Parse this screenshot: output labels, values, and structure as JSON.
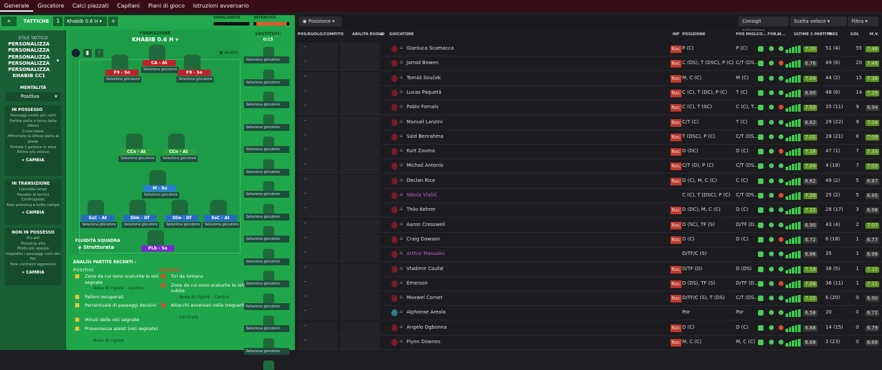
{
  "topnav": [
    "Generale",
    "Giocatore",
    "Calci piazzati",
    "Capitani",
    "Piani di gioco",
    "Istruzioni avversario"
  ],
  "tactics": {
    "label": "TATTICHE",
    "number": "1",
    "selected": "Khabib 0.6 H",
    "familiarity": "FAMILIARITÀ",
    "intensity": "INTENSITÀ"
  },
  "sidebar": {
    "style_title": "STILE TATTICO",
    "names": [
      "PERSONALIZZA",
      "PERSONALIZZA",
      "PERSONALIZZA",
      "PERSONALIZZA",
      "PERSONALIZZA",
      "KHABIB CC1"
    ],
    "mentality_title": "MENTALITÀ",
    "mentality": "Positiva",
    "in_possession": {
      "title": "IN POSSESSO",
      "lines": [
        "Passaggi molto più corti",
        "Partite palla a terra dalla difesa",
        "Cross bassi",
        "Affrontate la difesa palla al piede",
        "Portate il pallone in area",
        "Ritmo più veloce"
      ],
      "button": "CAMBIA"
    },
    "transition": {
      "title": "IN TRANSIZIONE",
      "lines": [
        "Lanciate lungo",
        "Passate ai terzini",
        "Contropiede",
        "Fate pressing a tutto campo"
      ],
      "button": "CAMBIA"
    },
    "out_possession": {
      "title": "NON IN POSSESSO",
      "lines": [
        "Più alti",
        "Pressing alto",
        "Molto più spesso",
        "Impedite i passaggi corti del Por",
        "Fate contrasti aggressivi"
      ],
      "button": "CAMBIA"
    }
  },
  "formation": {
    "title": "FORMAZIONE",
    "name": "KHABIB 0.6 H",
    "analysis": "Analisi",
    "fluidity_title": "FLUIDITÀ SQUADRA",
    "fluidity": "Strutturata"
  },
  "select_player": "Seleziona giocatore",
  "positions": [
    {
      "role": "F9 - So",
      "color": "#b8252c"
    },
    {
      "role": "CA - At",
      "color": "#b8252c"
    },
    {
      "role": "F9 - So",
      "color": "#b8252c"
    },
    {
      "role": "CCn - At",
      "color": "#2e9f3a"
    },
    {
      "role": "CCn - At",
      "color": "#2e9f3a"
    },
    {
      "role": "M - So",
      "color": "#2a7fd4"
    },
    {
      "role": "EsC - At",
      "color": "#2a68c8"
    },
    {
      "role": "Dlm - Df",
      "color": "#2a68c8"
    },
    {
      "role": "Dlm - Df",
      "color": "#2a68c8"
    },
    {
      "role": "EsC - At",
      "color": "#2a68c8"
    },
    {
      "role": "PLb - So",
      "color": "#7a2ad0"
    }
  ],
  "subs": {
    "title": "SOSTITUTI:",
    "count": "0/15"
  },
  "analysis": {
    "title": "ANALISI PARTITE RECENTI",
    "positive_title": "POSITIVI",
    "negative_title": "NEGATIVI",
    "positives": [
      {
        "text": "Zone da cui sono scaturite le reti segnate",
        "sub": "- Area di rigore - Centro"
      },
      {
        "text": "Palloni recuperati"
      },
      {
        "text": "Percentuale di passaggi decisivi"
      },
      {
        "text": "Minuti delle reti segnate"
      },
      {
        "text": "Provenienza assist (reti segnate)",
        "sub": "- Area di rigore"
      }
    ],
    "negatives": [
      {
        "text": "Tiri da lontano"
      },
      {
        "text": "Zone da cui sono scaturite le reti subite",
        "sub": "- Area di rigore - Centro"
      },
      {
        "text": "Attacchi avversari nella trequarti",
        "sub": "- Centrale"
      }
    ]
  },
  "right": {
    "position_btn": "Posizione",
    "consigli": "Consigli selezione",
    "scelta": "Scelta veloce",
    "filtra": "Filtra",
    "headers": [
      "POS/RUOLO/COMPITO",
      "ABILITÀ RUOLO",
      "IG",
      "GIOCATORE",
      "INF",
      "POSIZIONE",
      "POS MIGL",
      "CO...",
      "FOR...",
      "M...",
      "ULTIME 5 PARTITE",
      "PRES",
      "GOL",
      "M.V."
    ]
  },
  "players": [
    {
      "name": "Gianluca Scamacca",
      "inf": "Nac",
      "pos": "P (C)",
      "best": "P (C)",
      "last": "7.20",
      "pres": "51 (4)",
      "gol": "55",
      "mv": "7.46",
      "col": "#3ccb4a",
      "lc": "#5a8f1c"
    },
    {
      "name": "Jarrod Bowen",
      "inf": "Nac",
      "pos": "C (DS), T (DSC), P (C)",
      "best": "C/T (DS...",
      "last": "6.76",
      "pres": "49 (6)",
      "gol": "20",
      "mv": "7.48",
      "col": "#3ccb4a",
      "lc": "#3a3a3a"
    },
    {
      "name": "Tomáš Souček",
      "inf": "Nac",
      "pos": "M, C (C)",
      "best": "M (C)",
      "last": "7.04",
      "pres": "44 (2)",
      "gol": "15",
      "mv": "7.38",
      "col": "#3ccb4a",
      "lc": "#5a8f1c"
    },
    {
      "name": "Lucas Paquetá",
      "inf": "Nac",
      "pos": "C (C), T (DC), P (C)",
      "best": "T (C)",
      "last": "6.80",
      "pres": "48 (6)",
      "gol": "14",
      "mv": "7.29",
      "col": "#3ccb4a",
      "lc": "#3a3a3a"
    },
    {
      "name": "Pablo Fornals",
      "inf": "Nac",
      "pos": "C (C), T (SC)",
      "best": "C (C), T...",
      "last": "7.03",
      "pres": "35 (11)",
      "gol": "9",
      "mv": "6.94",
      "col": "#3ccb4a",
      "lc": "#5a8f1c"
    },
    {
      "name": "Manuel Lanzini",
      "inf": "Nac",
      "pos": "C/T (C)",
      "best": "T (C)",
      "last": "6.82",
      "pres": "29 (22)",
      "gol": "9",
      "mv": "7.04",
      "col": "#3ccb4a",
      "lc": "#3a3a3a"
    },
    {
      "name": "Said Benrahma",
      "inf": "Nac",
      "pos": "T (DSC), P (C)",
      "best": "C/T (DS...",
      "last": "7.02",
      "pres": "28 (21)",
      "gol": "8",
      "mv": "7.09",
      "col": "#3ccb4a",
      "lc": "#5a8f1c"
    },
    {
      "name": "Kurt Zouma",
      "inf": "Nac",
      "pos": "D (DC)",
      "best": "D (C)",
      "last": "7.16",
      "pres": "47 (1)",
      "gol": "7",
      "mv": "7.33",
      "col": "#3ccb4a",
      "lc": "#5a8f1c"
    },
    {
      "name": "Michail Antonio",
      "inf": "Nac",
      "pos": "C/T (D), P (C)",
      "best": "C/T (DS...",
      "last": "7.04",
      "pres": "4 (18)",
      "gol": "7",
      "mv": "7.02",
      "col": "#3ccb4a",
      "lc": "#5a8f1c"
    },
    {
      "name": "Declan Rice",
      "inf": "Nac",
      "pos": "D (C), M, C (C)",
      "best": "C (C)",
      "last": "6.82",
      "pres": "49 (2)",
      "gol": "5",
      "mv": "6.87",
      "col": "#3ccb4a",
      "lc": "#3a3a3a"
    },
    {
      "name": "Nikola Vlašić",
      "inf": "",
      "pos": "C (C), T (DSC), P (C)",
      "best": "C/T (DS...",
      "last": "7.20",
      "pres": "25 (2)",
      "gol": "5",
      "mv": "6.85",
      "col": "#b455c8",
      "lc": "#5a8f1c"
    },
    {
      "name": "Thilo Kehrer",
      "inf": "Nac",
      "pos": "D (DC), M, C (C)",
      "best": "D (C)",
      "last": "7.22",
      "pres": "28 (17)",
      "gol": "3",
      "mv": "6.98",
      "col": "#3ccb4a",
      "lc": "#5a8f1c"
    },
    {
      "name": "Aaron Cresswell",
      "inf": "Nac",
      "pos": "D (SC), TF (S)",
      "best": "D/TF (D...",
      "last": "6.90",
      "pres": "43 (4)",
      "gol": "2",
      "mv": "7.07",
      "col": "#3ccb4a",
      "lc": "#3a3a3a"
    },
    {
      "name": "Craig Dawson",
      "inf": "Nac",
      "pos": "D (C)",
      "best": "D (C)",
      "last": "6.72",
      "pres": "6 (18)",
      "gol": "1",
      "mv": "6.77",
      "col": "#3ccb4a",
      "lc": "#3a3a3a"
    },
    {
      "name": "Arthur Masuaku",
      "inf": "",
      "pos": "D/TF/C (S)",
      "best": "",
      "last": "6.86",
      "pres": "35",
      "gol": "1",
      "mv": "6.98",
      "col": "#b455c8",
      "lc": "#3a3a3a"
    },
    {
      "name": "Vladimír Coufal",
      "inf": "Nac",
      "pos": "D/TF (D)",
      "best": "D (DS)",
      "last": "7.14",
      "pres": "38 (5)",
      "gol": "1",
      "mv": "7.11",
      "col": "#3ccb4a",
      "lc": "#5a8f1c"
    },
    {
      "name": "Emerson",
      "inf": "Nac",
      "pos": "D (DS), TF (S)",
      "best": "D/TF (D...",
      "last": "7.04",
      "pres": "36 (11)",
      "gol": "1",
      "mv": "7.11",
      "col": "#3ccb4a",
      "lc": "#5a8f1c"
    },
    {
      "name": "Maxwel Cornet",
      "inf": "Nac",
      "pos": "D/TF/C (S), T (DS)",
      "best": "C/T (DS...",
      "last": "7.02",
      "pres": "6 (20)",
      "gol": "0",
      "mv": "6.90",
      "col": "#3ccb4a",
      "lc": "#5a8f1c"
    },
    {
      "name": "Alphonse Areola",
      "inf": "",
      "pos": "Por",
      "best": "Por",
      "last": "6.58",
      "pres": "20",
      "gol": "0",
      "mv": "6.72",
      "col": "#3ccb4a",
      "lc": "#3a3a3a"
    },
    {
      "name": "Angelo Ogbonna",
      "inf": "Nac",
      "pos": "D (C)",
      "best": "D (C)",
      "last": "6.88",
      "pres": "14 (15)",
      "gol": "0",
      "mv": "6.79",
      "col": "#3ccb4a",
      "lc": "#3a3a3a"
    },
    {
      "name": "Flynn Downes",
      "inf": "Nac",
      "pos": "M, C (C)",
      "best": "M, C (C)",
      "last": "6.68",
      "pres": "2 (23)",
      "gol": "0",
      "mv": "6.68",
      "col": "#3ccb4a",
      "lc": "#3a3a3a"
    }
  ]
}
